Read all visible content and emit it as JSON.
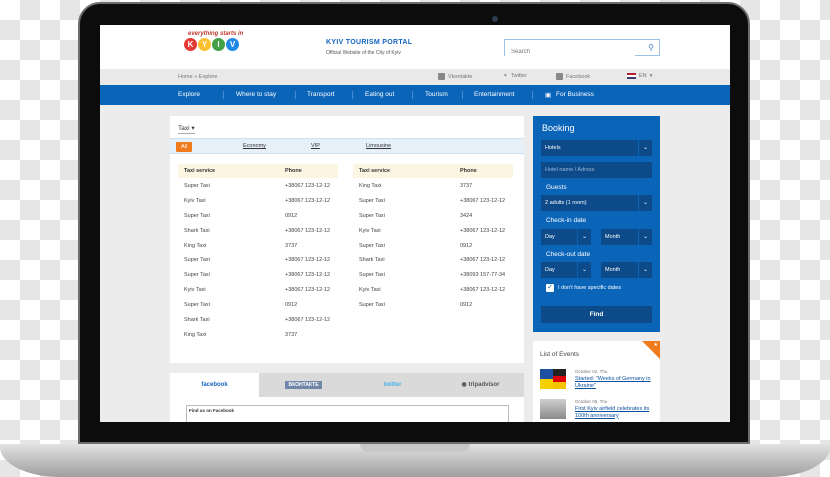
{
  "header": {
    "logo_tagline": "everything starts in",
    "logo_letters": [
      "K",
      "Y",
      "I",
      "V"
    ],
    "portal_title": "KYIV TOURISM PORTAL",
    "portal_subtitle": "Official Website of the City of Kyiv",
    "search_placeholder": "Search"
  },
  "subbar": {
    "breadcrumb": "Home » Explore",
    "social": [
      "Vkontakte",
      "Twitter",
      "Facebook"
    ],
    "lang": "EN"
  },
  "nav": {
    "items": [
      "Explore",
      "Where to stay",
      "Transport",
      "Eating out",
      "Tourism",
      "Entertainment",
      "For Business"
    ]
  },
  "taxi": {
    "dropdown": "Taxi",
    "filters": [
      "All",
      "Economy",
      "VIP",
      "Limousine"
    ],
    "headers": [
      "Taxi service",
      "Phone"
    ],
    "left_rows": [
      [
        "Super Taxi",
        "+38067 123-12-12"
      ],
      [
        "Kyiv Taxi",
        "+38067 123-12-12"
      ],
      [
        "Super Taxi",
        "0912"
      ],
      [
        "Shark Taxi",
        "+38067 123-12-12"
      ],
      [
        "King Taxi",
        "3737"
      ],
      [
        "Super Taxi",
        "+38067 123-12-12"
      ],
      [
        "Super Taxi",
        "+38067 123-12-12"
      ],
      [
        "Kyiv Taxi",
        "+38067 123-12-12"
      ],
      [
        "Super Taxi",
        "0912"
      ],
      [
        "Shark Taxi",
        "+38067 123-12-12"
      ],
      [
        "King Taxi",
        "3737"
      ]
    ],
    "right_rows": [
      [
        "King Taxi",
        "3737"
      ],
      [
        "Super Taxi",
        "+38067 123-12-12"
      ],
      [
        "Super Taxi",
        "3424"
      ],
      [
        "Kyiv Taxi",
        "+38067 123-12-12"
      ],
      [
        "Super Taxi",
        "0912"
      ],
      [
        "Shark Taxi",
        "+38067 123-12-12"
      ],
      [
        "Super Taxi",
        "+38093 157-77-34"
      ],
      [
        "Kyiv Taxi",
        "+38067 123-12-12"
      ],
      [
        "Super Taxi",
        "0912"
      ]
    ]
  },
  "social_tabs": {
    "tabs": [
      "facebook",
      "ВКОНТАКТЕ",
      "twitter",
      "tripadvisor"
    ],
    "find_us": "Find us on Facebook"
  },
  "booking": {
    "title": "Booking",
    "type_select": "Hotels",
    "hotel_placeholder": "Hotel name / Adress",
    "guests_label": "Guests",
    "guests_select": "2 adults (1 room)",
    "checkin_label": "Check-in date",
    "checkout_label": "Check-out date",
    "day": "Day",
    "month": "Month",
    "no_dates": "I don't have specific dates",
    "find": "Find"
  },
  "events": {
    "title": "List of Events",
    "items": [
      {
        "date": "October 02, Thu",
        "text": "Started: \"Weeks of Germany in Ukraine\""
      },
      {
        "date": "October 06, Thu",
        "text": "First Kyiv airfield celebrates its 100th anniversary"
      }
    ]
  },
  "colors": {
    "brand_blue": "#0a64b8",
    "accent_orange": "#f07b1d",
    "dark_field": "#0c4a8a"
  }
}
